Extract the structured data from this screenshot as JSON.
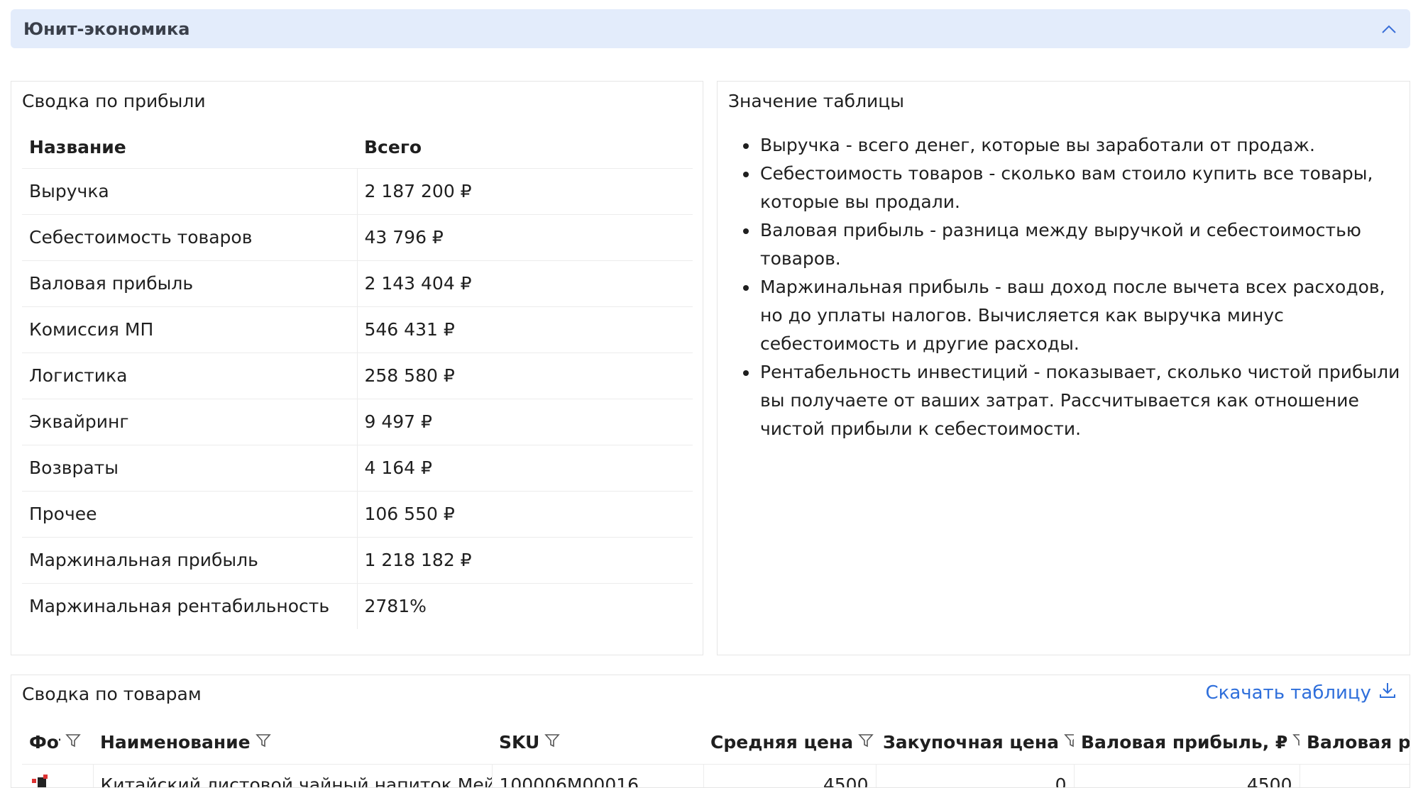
{
  "section": {
    "title": "Юнит-экономика"
  },
  "profit_summary": {
    "title": "Сводка по прибыли",
    "columns": [
      "Название",
      "Всего"
    ],
    "rows": [
      {
        "name": "Выручка",
        "value": "2 187 200 ₽"
      },
      {
        "name": "Себестоимость товаров",
        "value": "43 796 ₽"
      },
      {
        "name": "Валовая прибыль",
        "value": "2 143 404 ₽"
      },
      {
        "name": "Комиссия МП",
        "value": "546 431 ₽"
      },
      {
        "name": "Логистика",
        "value": "258 580 ₽"
      },
      {
        "name": "Эквайринг",
        "value": "9 497 ₽"
      },
      {
        "name": "Возвраты",
        "value": "4 164 ₽"
      },
      {
        "name": "Прочее",
        "value": "106 550 ₽"
      },
      {
        "name": "Маржинальная прибыль",
        "value": "1 218 182 ₽"
      },
      {
        "name": "Маржинальная рентабильность",
        "value": "2781%"
      }
    ]
  },
  "table_meaning": {
    "title": "Значение таблицы",
    "items": [
      "Выручка - всего денег, которые вы заработали от продаж.",
      "Себестоимость товаров - сколько вам стоило купить все товары, которые вы продали.",
      "Валовая прибыль - разница между выручкой и себестоимостью товаров.",
      "Маржинальная прибыль - ваш доход после вычета всех расходов, но до уплаты налогов. Вычисляется как выручка минус себестоимость и другие расходы.",
      "Рентабельность инвестиций - показывает, сколько чистой прибыли вы получаете от ваших затрат. Рассчитывается как отношение чистой прибыли к себестоимости."
    ]
  },
  "goods_summary": {
    "title": "Сводка по товарам",
    "download_label": "Скачать таблицу",
    "columns": [
      "Фото",
      "Наименование",
      "SKU",
      "Средняя цена",
      "Закупочная цена",
      "Валовая прибыль, ₽",
      "Валовая р"
    ],
    "rows": [
      {
        "name": "Китайский листовой чайный напиток Мей Гуй",
        "sku": "100006M00016",
        "avg_price": "4500",
        "purchase_price": "0",
        "gross_profit": "4500"
      }
    ]
  },
  "colors": {
    "header_bg": "#e3ecfb",
    "link": "#2f6fdb",
    "border": "#e6e6e6"
  },
  "icons": {
    "collapse": "chevron-up-icon",
    "filter": "filter-icon",
    "download": "download-icon"
  }
}
